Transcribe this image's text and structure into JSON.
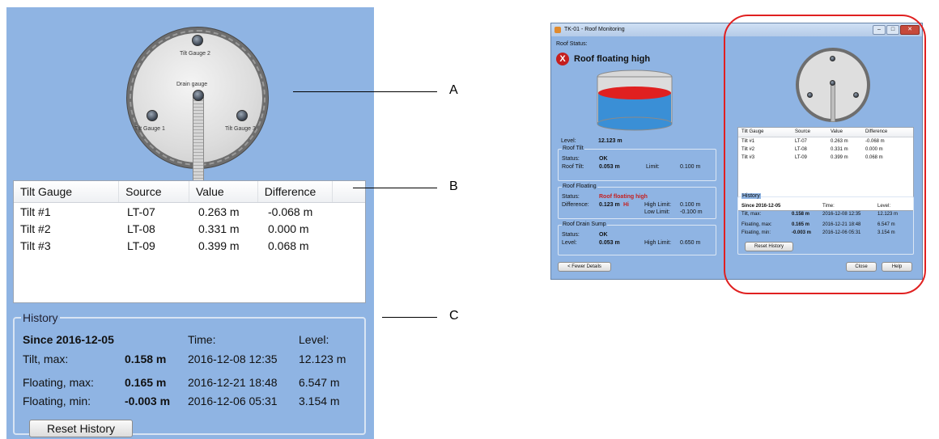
{
  "callouts": {
    "a": "A",
    "b": "B",
    "c": "C"
  },
  "zoom": {
    "gauges": {
      "tilt2": "Tilt Gauge 2",
      "drain": "Drain gauge",
      "tilt1": "Tilt Gauge 1",
      "tilt3": "Tilt Gauge 3"
    },
    "table": {
      "headers": [
        "Tilt Gauge",
        "Source",
        "Value",
        "Difference"
      ],
      "rows": [
        {
          "gauge": "Tilt #1",
          "source": "LT-07",
          "value": "0.263 m",
          "diff": "-0.068 m"
        },
        {
          "gauge": "Tilt #2",
          "source": "LT-08",
          "value": "0.331 m",
          "diff": "0.000 m"
        },
        {
          "gauge": "Tilt #3",
          "source": "LT-09",
          "value": "0.399 m",
          "diff": "0.068 m"
        }
      ]
    },
    "history": {
      "legend": "History",
      "since": "Since 2016-12-05",
      "time_h": "Time:",
      "level_h": "Level:",
      "rows": [
        {
          "label": "Tilt, max:",
          "value": "0.158 m",
          "time": "2016-12-08 12:35",
          "level": "12.123 m"
        },
        {
          "label": "Floating, max:",
          "value": "0.165 m",
          "time": "2016-12-21 18:48",
          "level": "6.547 m"
        },
        {
          "label": "Floating, min:",
          "value": "-0.003 m",
          "time": "2016-12-06 05:31",
          "level": "3.154 m"
        }
      ],
      "reset": "Reset History"
    }
  },
  "dialog": {
    "title": "TK-01 - Roof Monitoring",
    "roof_status_label": "Roof Status:",
    "status_text": "Roof floating high",
    "level_label": "Level:",
    "level_value": "12.123 m",
    "roof_tilt": {
      "legend": "Roof Tilt",
      "status_label": "Status:",
      "status": "OK",
      "tilt_label": "Roof Tilt:",
      "tilt": "0.053 m",
      "limit_label": "Limit:",
      "limit": "0.100 m"
    },
    "roof_floating": {
      "legend": "Roof Floating",
      "status_label": "Status:",
      "status": "Roof floating high",
      "diff_label": "Difference:",
      "diff": "0.123 m",
      "hi": "Hi",
      "high_label": "High Limit:",
      "high": "0.100 m",
      "low_label": "Low Limit:",
      "low": "-0.100 m"
    },
    "drain": {
      "legend": "Roof Drain Sump",
      "status_label": "Status:",
      "status": "OK",
      "level_label": "Level:",
      "level": "0.053 m",
      "high_label": "High Limit:",
      "high": "0.650 m"
    },
    "fewer": "< Fewer Details",
    "close": "Close",
    "help": "Help",
    "colors": {
      "alarm_red": "#c51f1f",
      "liquid_blue": "#3a8fd6",
      "roof_red": "#e02020"
    }
  }
}
